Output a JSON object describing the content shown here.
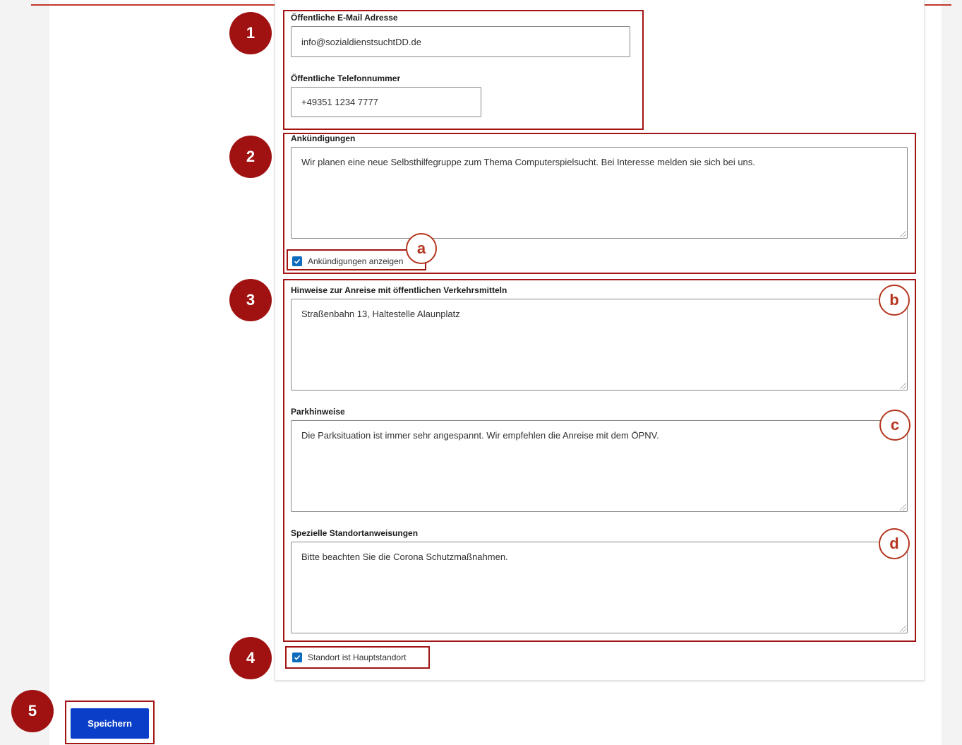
{
  "contact": {
    "email_label": "Öffentliche E-Mail Adresse",
    "email_value": "info@sozialdienstsuchtDD.de",
    "phone_label": "Öffentliche Telefonnummer",
    "phone_value": "+49351 1234 7777"
  },
  "announcements": {
    "label": "Ankündigungen",
    "value": "Wir planen eine neue Selbsthilfegruppe zum Thema Computerspielsucht. Bei Interesse melden sie sich bei uns.",
    "show_label": "Ankündigungen anzeigen",
    "show_checked": true
  },
  "directions": {
    "transit_label": "Hinweise zur Anreise mit öffentlichen Verkehrsmitteln",
    "transit_value": "Straßenbahn 13, Haltestelle Alaunplatz",
    "parking_label": "Parkhinweise",
    "parking_value": "Die Parksituation ist immer sehr angespannt. Wir empfehlen die Anreise mit dem ÖPNV.",
    "special_label": "Spezielle Standortanweisungen",
    "special_value": "Bitte beachten Sie die Corona Schutzmaßnahmen."
  },
  "main_location": {
    "label": "Standort ist Hauptstandort",
    "checked": true
  },
  "actions": {
    "save_label": "Speichern"
  },
  "callouts": {
    "numbers": [
      "1",
      "2",
      "3",
      "4",
      "5"
    ],
    "letters": [
      "a",
      "b",
      "c",
      "d"
    ]
  },
  "colors": {
    "highlight": "#a31515",
    "badge": "#a01212",
    "checkbox": "#0f6cbd",
    "save_button": "#0a3ec9"
  }
}
